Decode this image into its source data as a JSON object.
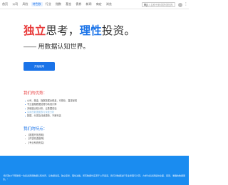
{
  "nav": {
    "items": [
      "首页",
      "公司",
      "风险",
      "特色数",
      "行业",
      "指数",
      "基金",
      "债券",
      "新闻",
      "商定",
      "浏览"
    ],
    "active_index": 3,
    "search_placeholder": "输入名称/代码/简拼/按回车",
    "user_icon": "user-icon",
    "more_icon": "more-icon"
  },
  "hero": {
    "headline_part1": "独立",
    "headline_part2": "思考，",
    "headline_part3": "理性",
    "headline_part4": "投资。",
    "subline": "—— 用数据认知世界。",
    "cta_label": "开始使用"
  },
  "advantages": {
    "title": "我们的优势：",
    "items": [
      "公司、基金、指数数据全覆盖，可视化、直观呈现",
      "专业金融数据处理与精准计算",
      "多维度比较分析，让数据说话",
      "实用的数据图表与深度分析",
      "数据、分类及持续更新，不断完善"
    ]
  },
  "features": {
    "title": "我们的特点：",
    "items": [
      "【数据开放透明】",
      "【内容精选推荐】",
      "【专业系统完善】"
    ]
  },
  "bottom": {
    "text": "“我们致力于帮助每一位投资者用数据认知世界，让数据说话，独立思考，理性决策。所有数据均来源于公开渠道，我们对数据进行专业整理与计算，力求为投资者提供全面、客观、准确的数据服务。”"
  },
  "colors": {
    "accent_blue": "#1a73e8",
    "accent_red": "#e83a3a",
    "band_blue": "#1a8cf0"
  }
}
